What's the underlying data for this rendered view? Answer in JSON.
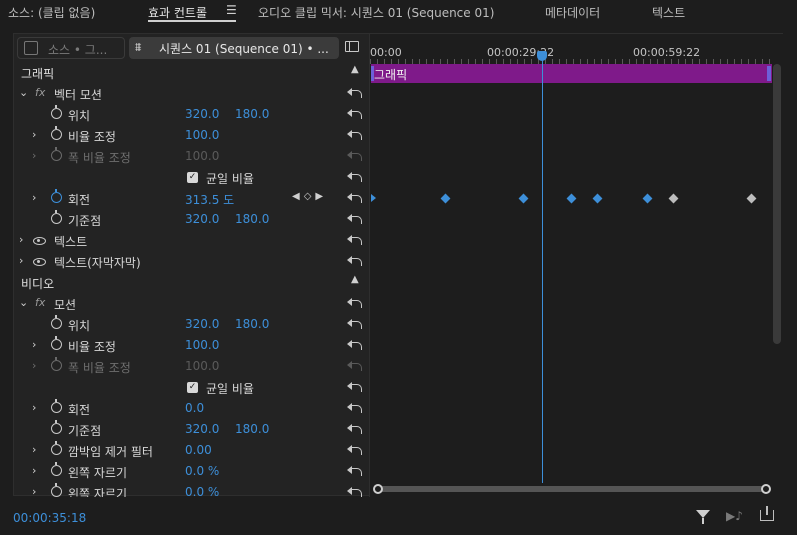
{
  "tabs": [
    {
      "label": "소스: (클립 없음)"
    },
    {
      "label": "효과 컨트롤"
    },
    {
      "label": "오디오 클립 믹서: 시퀀스 01 (Sequence 01)"
    },
    {
      "label": "메타데이터"
    },
    {
      "label": "텍스트"
    }
  ],
  "menu_icon": "☰",
  "clip_selector": {
    "source_label": "소스 • 그...",
    "sequence_label": "시퀀스 01 (Sequence 01) • ..."
  },
  "sections": {
    "graphic": "그래픽",
    "video": "비디오"
  },
  "props": {
    "vector_motion": "벡터 모션",
    "position_label": "위치",
    "position_x": "320.0",
    "position_y": "180.0",
    "scale_label": "비율 조정",
    "scale_val": "100.0",
    "width_scale_label": "폭 비율 조정",
    "width_scale_val": "100.0",
    "uniform_label": "균일 비율",
    "rotation_label": "회전",
    "rotation_val": "313.5 도",
    "anchor_label": "기준점",
    "anchor_x": "320.0",
    "anchor_y": "180.0",
    "text1": "텍스트",
    "text2": "텍스트(자막자막)",
    "motion": "모션",
    "v_position_x": "320.0",
    "v_position_y": "180.0",
    "v_scale_val": "100.0",
    "v_width_scale_val": "100.0",
    "v_rotation_val": "0.0",
    "v_anchor_x": "320.0",
    "v_anchor_y": "180.0",
    "antiflicker_label": "깜박임 제거 필터",
    "antiflicker_val": "0.00",
    "crop_left_label": "왼쪽 자르기",
    "crop_left_val": "0.0 %",
    "crop_left2_label": "왼쪽 자르기",
    "crop_left2_val": "0.0 %"
  },
  "timeline": {
    "ticks": [
      "00:00",
      "00:00:29:22",
      "00:00:59:22"
    ],
    "clip_label": "그래픽"
  },
  "current_timecode": "00:00:35:18",
  "colors": {
    "accent": "#3d8fd9",
    "clip": "#7f1a8a"
  }
}
